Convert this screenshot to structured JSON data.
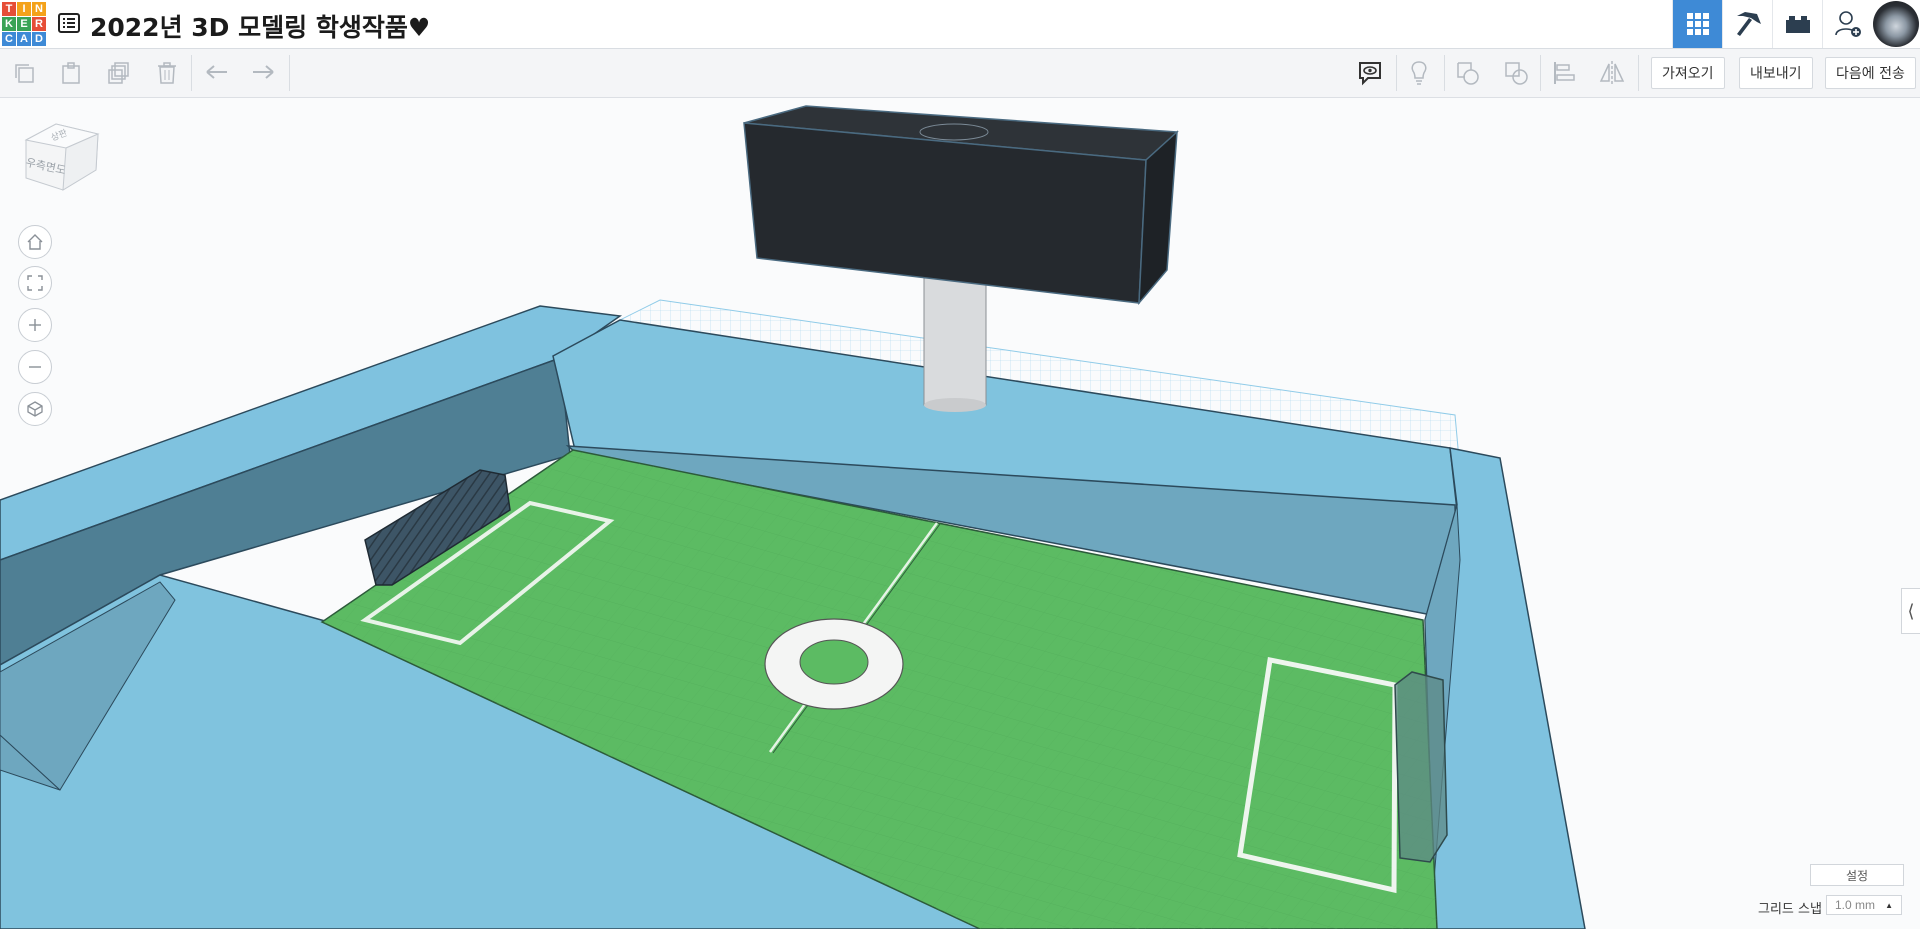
{
  "app": {
    "logo_letters": [
      "T",
      "I",
      "N",
      "K",
      "E",
      "R",
      "C",
      "A",
      "D"
    ],
    "logo_colors": [
      "#e64e37",
      "#f4a21a",
      "#f4a21a",
      "#3aa356",
      "#3aa356",
      "#e64e37",
      "#3e8ad6",
      "#3e8ad6",
      "#3e8ad6"
    ],
    "title": "2022년 3D 모델링 학생작품♥",
    "accent": "#3e8ad6"
  },
  "header": {
    "icons": [
      "grid-icon",
      "pickaxe-icon",
      "brick-icon",
      "add-user-icon"
    ]
  },
  "toolbar": {
    "import_label": "가져오기",
    "export_label": "내보내기",
    "send_to_label": "다음에 전송"
  },
  "viewcube": {
    "face_front": "우측면도",
    "face_top": "상판"
  },
  "bottom": {
    "settings_label": "설정",
    "grid_snap_label": "그리드 스냅",
    "grid_snap_value": "1.0 mm"
  },
  "scene": {
    "field_color": "#5cbb63",
    "wall_color": "#80c3de",
    "scoreboard_color": "#25292e"
  }
}
